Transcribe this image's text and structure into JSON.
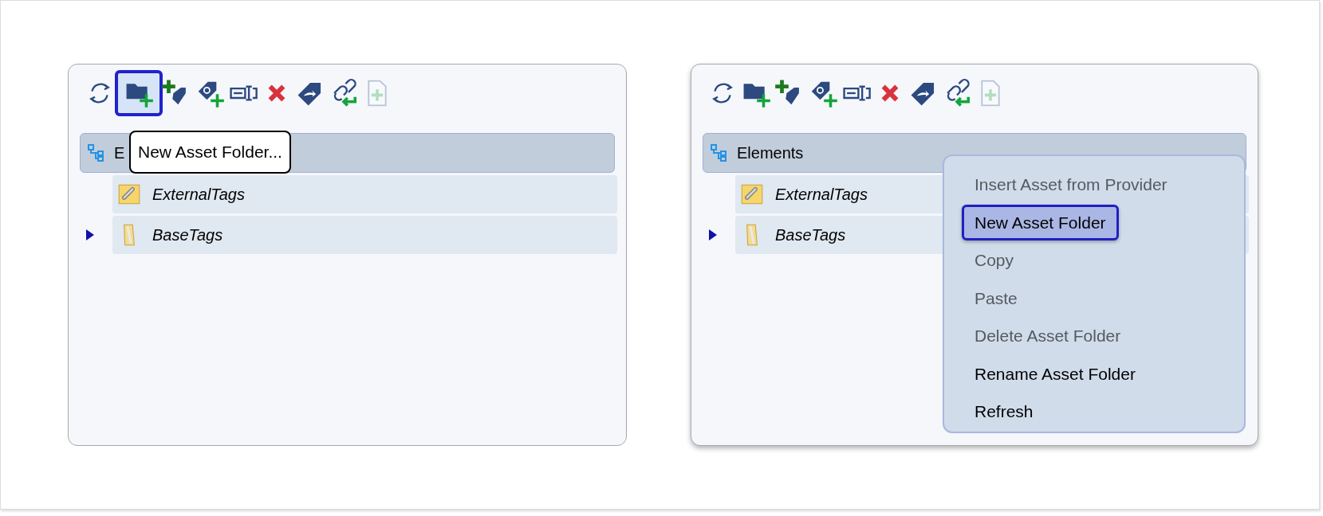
{
  "panels": [
    {
      "toolbar": [
        {
          "kind": "refresh",
          "selected": false,
          "disabled": false
        },
        {
          "kind": "new-folder",
          "selected": true,
          "disabled": false
        },
        {
          "kind": "add-tag",
          "selected": false,
          "disabled": false
        },
        {
          "kind": "add-link-tag",
          "selected": false,
          "disabled": false
        },
        {
          "kind": "rename",
          "selected": false,
          "disabled": false
        },
        {
          "kind": "delete",
          "selected": false,
          "disabled": false
        },
        {
          "kind": "tag-arrow",
          "selected": false,
          "disabled": false
        },
        {
          "kind": "link-return",
          "selected": false,
          "disabled": false
        },
        {
          "kind": "new-file",
          "selected": false,
          "disabled": true
        }
      ],
      "tree": {
        "label": "E",
        "selected": true,
        "children": [
          {
            "label": "ExternalTags",
            "kind": "link-folder"
          },
          {
            "label": "BaseTags",
            "kind": "folder",
            "expanded": false
          }
        ]
      },
      "tooltip": "New Asset Folder..."
    },
    {
      "toolbar": [
        {
          "kind": "refresh",
          "selected": false,
          "disabled": false
        },
        {
          "kind": "new-folder",
          "selected": false,
          "disabled": false
        },
        {
          "kind": "add-tag",
          "selected": false,
          "disabled": false
        },
        {
          "kind": "add-link-tag",
          "selected": false,
          "disabled": false
        },
        {
          "kind": "rename",
          "selected": false,
          "disabled": false
        },
        {
          "kind": "delete",
          "selected": false,
          "disabled": false
        },
        {
          "kind": "tag-arrow",
          "selected": false,
          "disabled": false
        },
        {
          "kind": "link-return",
          "selected": false,
          "disabled": false
        },
        {
          "kind": "new-file",
          "selected": false,
          "disabled": true
        }
      ],
      "tree": {
        "label": "Elements",
        "selected": true,
        "children": [
          {
            "label": "ExternalTags",
            "kind": "link-folder"
          },
          {
            "label": "BaseTags",
            "kind": "folder",
            "expanded": false
          }
        ]
      },
      "context_menu": [
        {
          "label": "Insert Asset from Provider",
          "disabled": true,
          "selected": false
        },
        {
          "label": "New Asset Folder",
          "disabled": false,
          "selected": true
        },
        {
          "label": "Copy",
          "disabled": true,
          "selected": false
        },
        {
          "label": "Paste",
          "disabled": true,
          "selected": false
        },
        {
          "label": "Delete Asset Folder",
          "disabled": true,
          "selected": false
        },
        {
          "label": "Rename Asset Folder",
          "disabled": false,
          "selected": false
        },
        {
          "label": "Refresh",
          "disabled": false,
          "selected": false
        }
      ]
    }
  ]
}
